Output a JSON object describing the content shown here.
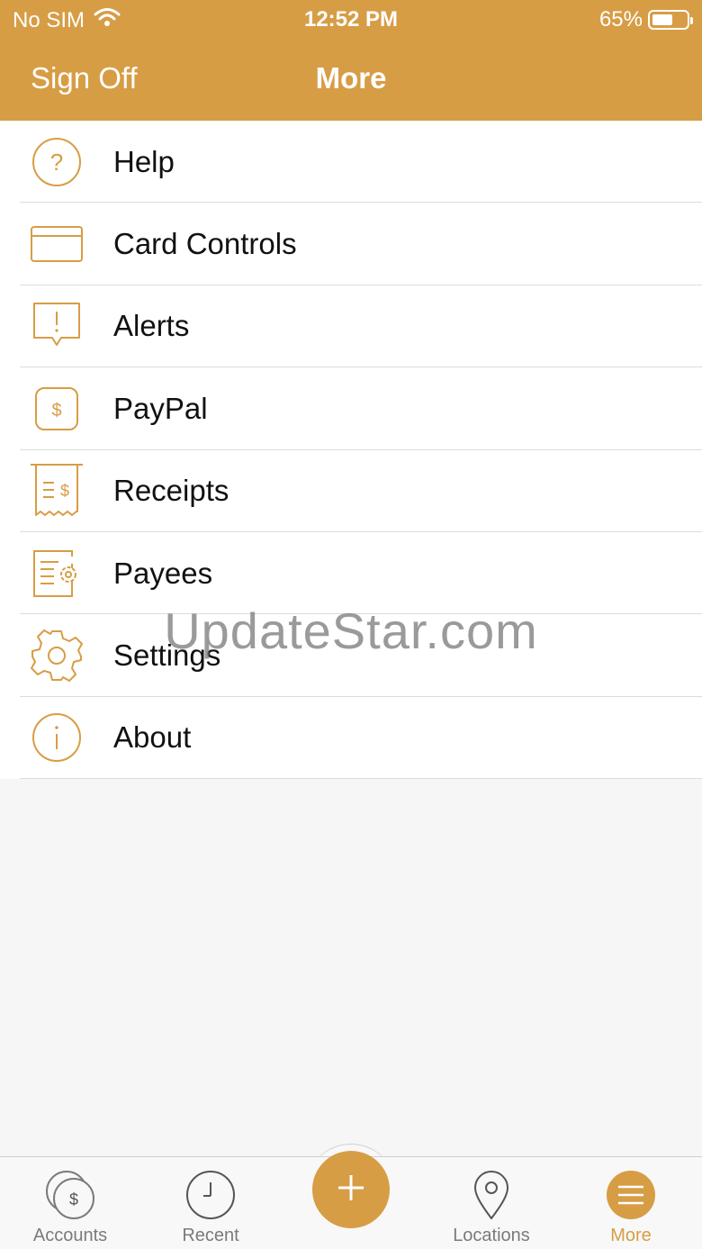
{
  "status_bar": {
    "carrier": "No SIM",
    "time": "12:52 PM",
    "battery": "65%",
    "battery_level": 0.65
  },
  "nav": {
    "left_button": "Sign Off",
    "title": "More"
  },
  "menu": {
    "items": [
      {
        "label": "Help",
        "icon": "help-icon"
      },
      {
        "label": "Card Controls",
        "icon": "card-icon"
      },
      {
        "label": "Alerts",
        "icon": "alert-icon"
      },
      {
        "label": "PayPal",
        "icon": "paypal-icon"
      },
      {
        "label": "Receipts",
        "icon": "receipt-icon"
      },
      {
        "label": "Payees",
        "icon": "payees-icon"
      },
      {
        "label": "Settings",
        "icon": "gear-icon"
      },
      {
        "label": "About",
        "icon": "info-icon"
      }
    ]
  },
  "watermark": "UpdateStar.com",
  "tabbar": {
    "tabs": [
      {
        "label": "Accounts",
        "icon": "accounts-icon"
      },
      {
        "label": "Recent",
        "icon": "clock-icon"
      },
      {
        "label": "",
        "icon": "plus-icon"
      },
      {
        "label": "Locations",
        "icon": "location-pin-icon"
      },
      {
        "label": "More",
        "icon": "menu-icon"
      }
    ],
    "active": "More"
  },
  "colors": {
    "accent": "#d79d45",
    "text": "#111111",
    "inactive": "#7a7a7a"
  }
}
